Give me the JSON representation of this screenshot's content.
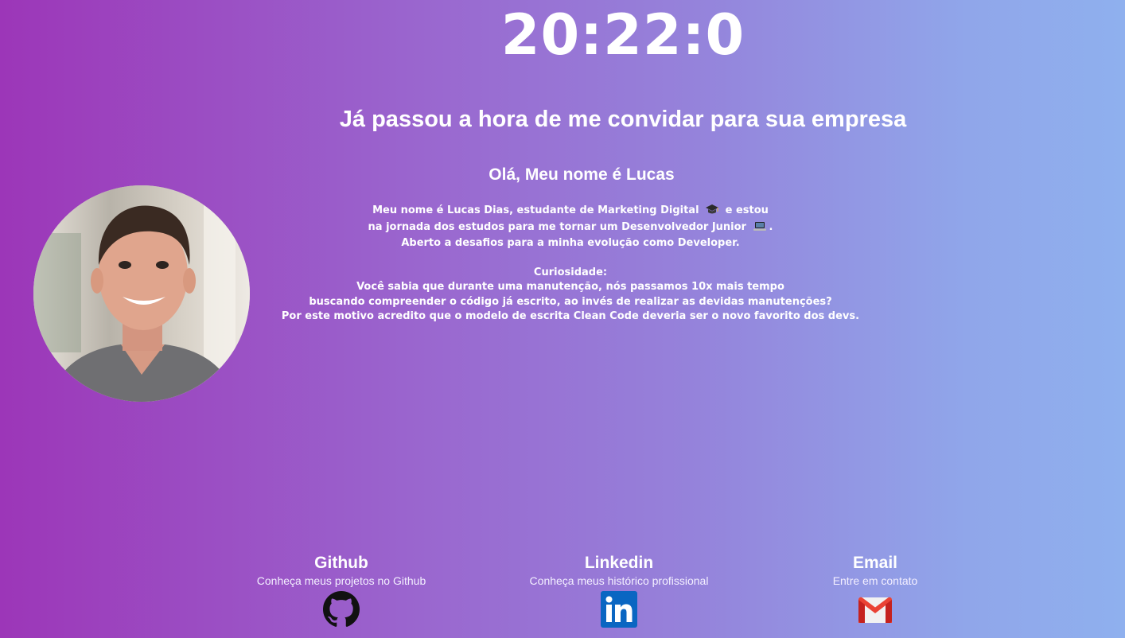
{
  "clock": "20:22:0",
  "headline": "Já passou a hora de me convidar para sua empresa",
  "greeting": "Olá, Meu nome é Lucas",
  "bio": {
    "line1_a": "Meu nome é Lucas Dias, estudante de Marketing Digital",
    "line1_b": "e estou",
    "line2_a": "na jornada dos estudos para me tornar um Desenvolvedor Junior",
    "line2_b": ".",
    "line3": "Aberto a desafios para a minha evolução como Developer.",
    "curiosity_title": "Curiosidade:",
    "curiosity_1": "Você sabia que durante uma manutenção, nós passamos 10x mais tempo",
    "curiosity_2": "buscando compreender o código já escrito, ao invés de realizar as devidas manutenções?",
    "curiosity_3": "Por este motivo acredito que o modelo de escrita Clean Code deveria ser o novo favorito dos devs."
  },
  "icons": {
    "graduation": "graduation-cap-icon",
    "laptop": "laptop-icon"
  },
  "links": [
    {
      "title": "Github",
      "subtitle": "Conheça meus projetos no Github",
      "icon": "github-icon"
    },
    {
      "title": "Linkedin",
      "subtitle": "Conheça meus histórico profissional",
      "icon": "linkedin-icon"
    },
    {
      "title": "Email",
      "subtitle": "Entre em contato",
      "icon": "gmail-icon"
    }
  ],
  "colors": {
    "gradient_start": "#9c36b8",
    "gradient_end": "#8fb0ee",
    "linkedin_blue": "#0a66c2",
    "gmail_red": "#ea4335"
  }
}
